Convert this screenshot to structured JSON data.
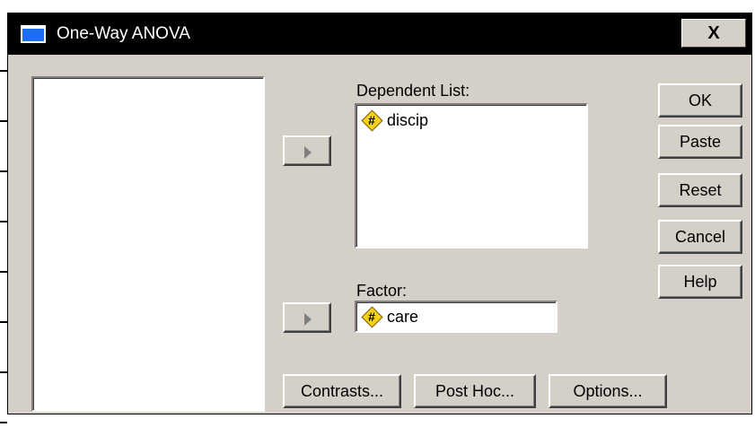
{
  "window": {
    "title": "One-Way ANOVA",
    "close_glyph": "X"
  },
  "dependent_list": {
    "label": "Dependent List:",
    "items": [
      "discip"
    ]
  },
  "factor": {
    "label": "Factor:",
    "value": "care"
  },
  "side_buttons": {
    "ok": "OK",
    "paste": "Paste",
    "reset": "Reset",
    "cancel": "Cancel",
    "help": "Help"
  },
  "bottom_buttons": {
    "contrasts": "Contrasts...",
    "post_hoc": "Post Hoc...",
    "options": "Options..."
  },
  "icons": {
    "variable": "scale-variable-icon",
    "move": "move-right-arrow-icon"
  }
}
